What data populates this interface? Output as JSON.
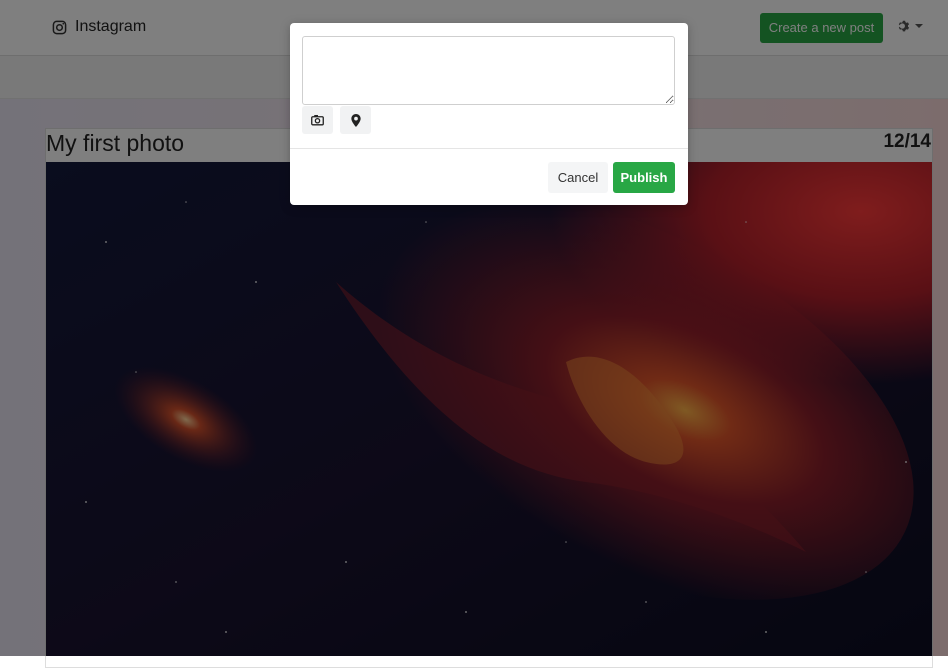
{
  "navbar": {
    "brand": "Instagram",
    "create_post_label": "Create a new post",
    "settings_icon": "gear-icon"
  },
  "post": {
    "title": "My first photo",
    "counter": "12/14"
  },
  "modal": {
    "textarea_value": "",
    "photo_tool_icon": "camera-icon",
    "location_tool_icon": "map-marker-icon",
    "cancel_label": "Cancel",
    "publish_label": "Publish"
  },
  "colors": {
    "primary_green": "#28a745",
    "overlay": "rgba(0,0,0,0.5)"
  }
}
